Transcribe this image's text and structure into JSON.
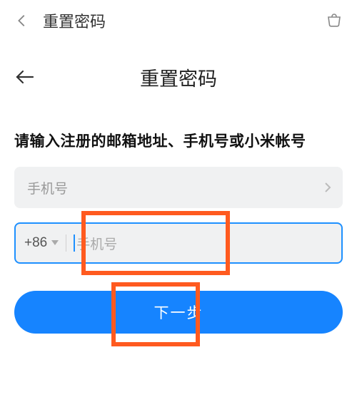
{
  "topbar": {
    "title": "重置密码"
  },
  "header": {
    "title": "重置密码"
  },
  "instruction": "请输入注册的邮箱地址、手机号或小米帐号",
  "selector": {
    "label": "手机号"
  },
  "phone": {
    "country_code": "+86",
    "placeholder": "手机号",
    "value": ""
  },
  "submit": {
    "label": "下一步"
  }
}
